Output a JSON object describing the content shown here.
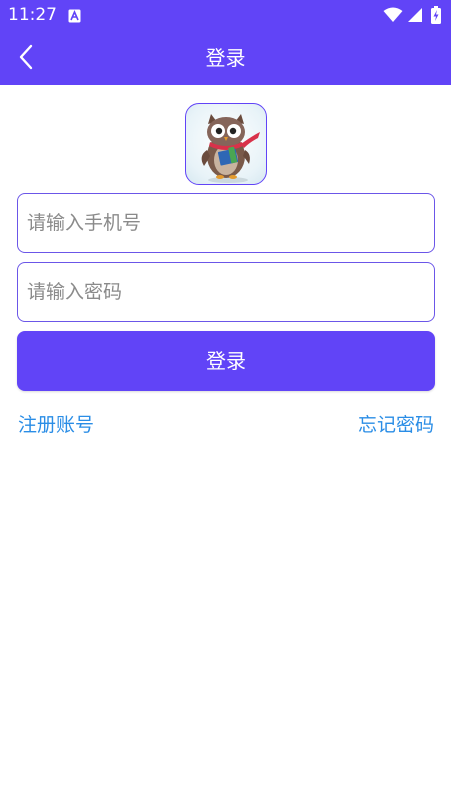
{
  "status_bar": {
    "time": "11:27",
    "notification_icon": "font-a-icon",
    "icons": [
      "wifi-icon",
      "signal-icon",
      "battery-charging-icon"
    ]
  },
  "app_bar": {
    "title": "登录",
    "back_icon": "chevron-left-icon"
  },
  "logo": {
    "icon": "owl-mascot-logo"
  },
  "form": {
    "phone_placeholder": "请输入手机号",
    "password_placeholder": "请输入密码",
    "login_label": "登录"
  },
  "links": {
    "register": "注册账号",
    "forgot_password": "忘记密码"
  },
  "colors": {
    "primary": "#6144f7",
    "link": "#2a8de6",
    "placeholder": "#8a8a8a"
  }
}
